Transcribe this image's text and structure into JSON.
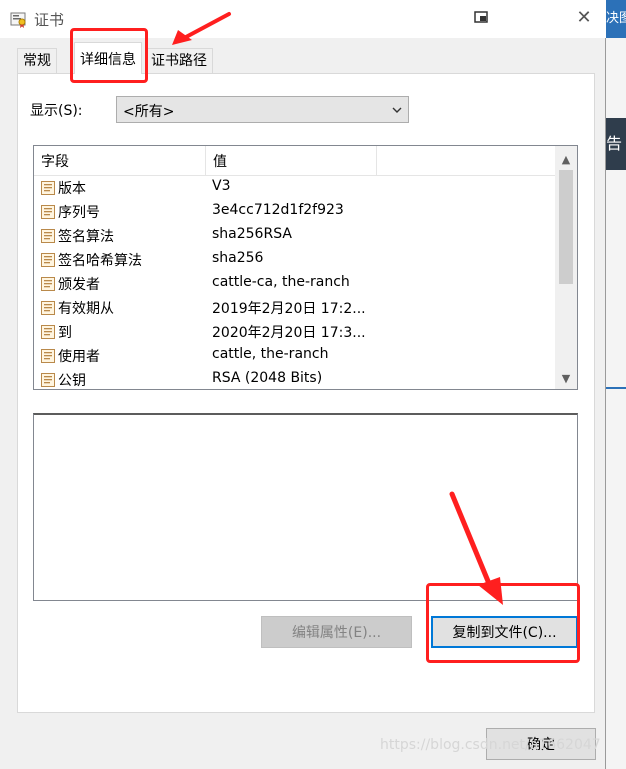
{
  "background_app": {
    "top_bar_text": "决图",
    "side_text": "告"
  },
  "window": {
    "title": "证书",
    "icon": "certificate-icon",
    "close_glyph": "✕"
  },
  "tabs": [
    {
      "label": "常规",
      "active": false
    },
    {
      "label": "详细信息",
      "active": true
    },
    {
      "label": "证书路径",
      "active": false
    }
  ],
  "show": {
    "label": "显示(S):",
    "selected": "<所有>"
  },
  "table": {
    "columns": [
      "字段",
      "值"
    ],
    "rows": [
      {
        "field": "版本",
        "value": "V3"
      },
      {
        "field": "序列号",
        "value": "3e4cc712d1f2f923"
      },
      {
        "field": "签名算法",
        "value": "sha256RSA"
      },
      {
        "field": "签名哈希算法",
        "value": "sha256"
      },
      {
        "field": "颁发者",
        "value": "cattle-ca, the-ranch"
      },
      {
        "field": "有效期从",
        "value": "2019年2月20日 17:2..."
      },
      {
        "field": "到",
        "value": "2020年2月20日 17:3..."
      },
      {
        "field": "使用者",
        "value": "cattle, the-ranch"
      },
      {
        "field": "公钥",
        "value": "RSA (2048 Bits)"
      }
    ]
  },
  "buttons": {
    "edit_properties": "编辑属性(E)...",
    "copy_to_file": "复制到文件(C)...",
    "ok": "确定"
  },
  "watermark": "https://blog.csdn.net/a1662047",
  "colors": {
    "annotation": "#ff1f1f",
    "focus": "#0078d7"
  }
}
